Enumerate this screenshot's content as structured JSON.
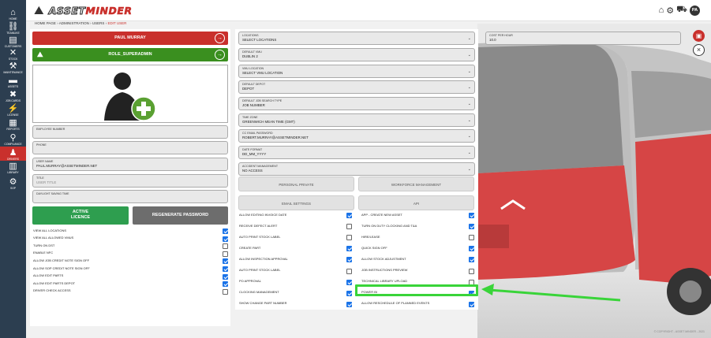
{
  "app": {
    "logo_text_a": "ASSET",
    "logo_text_b": "MINDER"
  },
  "user_initials": "PA",
  "sidebar": [
    {
      "icon": "⌂",
      "label": "HOME"
    },
    {
      "icon": "⛓",
      "label": "TEAMLIKE"
    },
    {
      "icon": "▤",
      "label": "CUSTOMERS"
    },
    {
      "icon": "✕",
      "label": "STOCK"
    },
    {
      "icon": "⚒",
      "label": "MAINTENANCE"
    },
    {
      "icon": "▬",
      "label": "ASSETS"
    },
    {
      "icon": "✖",
      "label": "JOB CARDS"
    },
    {
      "icon": "⚡",
      "label": "LICENSE"
    },
    {
      "icon": "▦",
      "label": "REPORTS"
    },
    {
      "icon": "⚲",
      "label": "COMPLIANCE"
    },
    {
      "icon": "♟",
      "label": "DRIVERS"
    },
    {
      "icon": "▥",
      "label": "LIBRARY"
    },
    {
      "icon": "⚙",
      "label": "SOP"
    }
  ],
  "breadcrumb": {
    "home": "HOME PAGE",
    "admin": "ADMINISTRATION",
    "users": "USERS",
    "current": "EDIT USER",
    "sep": "›"
  },
  "user": {
    "name": "PAUL MURRAY",
    "role": "ROLE_SUPERADMIN"
  },
  "left_fields": {
    "employee_number": {
      "label": "EMPLOYEE NUMBER",
      "value": ""
    },
    "phone": {
      "label": "PHONE",
      "value": ""
    },
    "username": {
      "label": "USER NAME",
      "value": "PAUL.MURRAY@ASSETMINDER.NET"
    },
    "title": {
      "label": "TITLE",
      "placeholder": "USER TITLE"
    },
    "dst": {
      "label": "DAYLIGHT SAVING TIME",
      "value": ""
    }
  },
  "status_button": {
    "line1": "ACTIVE",
    "line2": "LICENCE"
  },
  "regen_button": "REGENERATE PASSWORD",
  "left_checks": [
    {
      "label": "VIEW ALL LOCATIONS",
      "checked": true
    },
    {
      "label": "VIEW ALL ALLOWED VMUS",
      "checked": true
    },
    {
      "label": "TURN ON DST",
      "checked": false
    },
    {
      "label": "ENABLE NFC",
      "checked": false
    },
    {
      "label": "ALLOW JOB CREDIT NOTE SIGN OFF",
      "checked": true
    },
    {
      "label": "ALLOW SOP CREDIT NOTE SIGN OFF",
      "checked": true
    },
    {
      "label": "ALLOW EDIT PARTS",
      "checked": true
    },
    {
      "label": "ALLOW EDIT PARTS DEPOT",
      "checked": true
    },
    {
      "label": "DRIVER CHECK ACCESS",
      "checked": false
    }
  ],
  "mid_fields": [
    {
      "label": "LOCATIONS",
      "value": "SELECT LOCATIONS"
    },
    {
      "label": "DEFAULT VMU",
      "value": "DUBLIN 2"
    },
    {
      "label": "VMU LOCATION",
      "value": "SELECT VMU LOCATION"
    },
    {
      "label": "DEFAULT DEPOT",
      "value": "DEPOT"
    },
    {
      "label": "DEFAULT JOB SEARCH TYPE",
      "value": "JOB NUMBER"
    },
    {
      "label": "TIME ZONE",
      "value": "GREENWICH MEAN TIME (GMT)"
    },
    {
      "label": "CC EMAIL PASSWORD",
      "value": "ROBERT.MURRAY@ASSETMINDER.NET"
    },
    {
      "label": "DATE FORMAT",
      "value": "DD_MM_YYYY"
    },
    {
      "label": "ACCIDENT MANAGEMENT",
      "value": "NO ACCESS"
    }
  ],
  "tabs": [
    "PERSONAL PRIVATE",
    "WORKFORCE MANAGEMENT",
    "EMAIL SETTINGS",
    "API"
  ],
  "mid_checks_a": [
    {
      "label": "ALLOW EDITING INVOICE DATE",
      "checked": true
    },
    {
      "label": "RECEIVE DEFECT ALERT",
      "checked": false
    },
    {
      "label": "AUTO PRINT STOCK LABEL",
      "checked": false
    },
    {
      "label": "CREATE PART",
      "checked": true
    },
    {
      "label": "ALLOW INSPECTION APPROVAL",
      "checked": true
    },
    {
      "label": "AUTO PRINT STOCK LABEL",
      "checked": false
    },
    {
      "label": "PO APPROVAL",
      "checked": true
    },
    {
      "label": "CLOCKING MANAGEMENT",
      "checked": true
    },
    {
      "label": "SHOW CHANGE PART NUMBER",
      "checked": true
    }
  ],
  "mid_checks_b": [
    {
      "label": "APP - CREATE NEW ASSET",
      "checked": true
    },
    {
      "label": "TURN ON DUTY CLOCKING AND T&A",
      "checked": true
    },
    {
      "label": "HIRE/LEASE",
      "checked": false
    },
    {
      "label": "QUICK SIGN OFF",
      "checked": true
    },
    {
      "label": "ALLOW STOCK ADJUSTMENT",
      "checked": true
    },
    {
      "label": "JOB INSTRUCTIONS PREVIEW",
      "checked": false
    },
    {
      "label": "TECHNICAL LIBRARY UPLOAD",
      "checked": false
    },
    {
      "label": "POWER BI",
      "checked": true
    },
    {
      "label": "ALLOW RESCHEDULE OF PLANNED EVENTS",
      "checked": true
    }
  ],
  "cost": {
    "label": "COST PER HOUR",
    "value": "10.0"
  },
  "copyright": "© COPYRIGHT - ASSET MINDER - 2021",
  "colors": {
    "red": "#c9302c",
    "green": "#3a8f1f",
    "highlight": "#39d439",
    "sidebar": "#2c3e50"
  }
}
